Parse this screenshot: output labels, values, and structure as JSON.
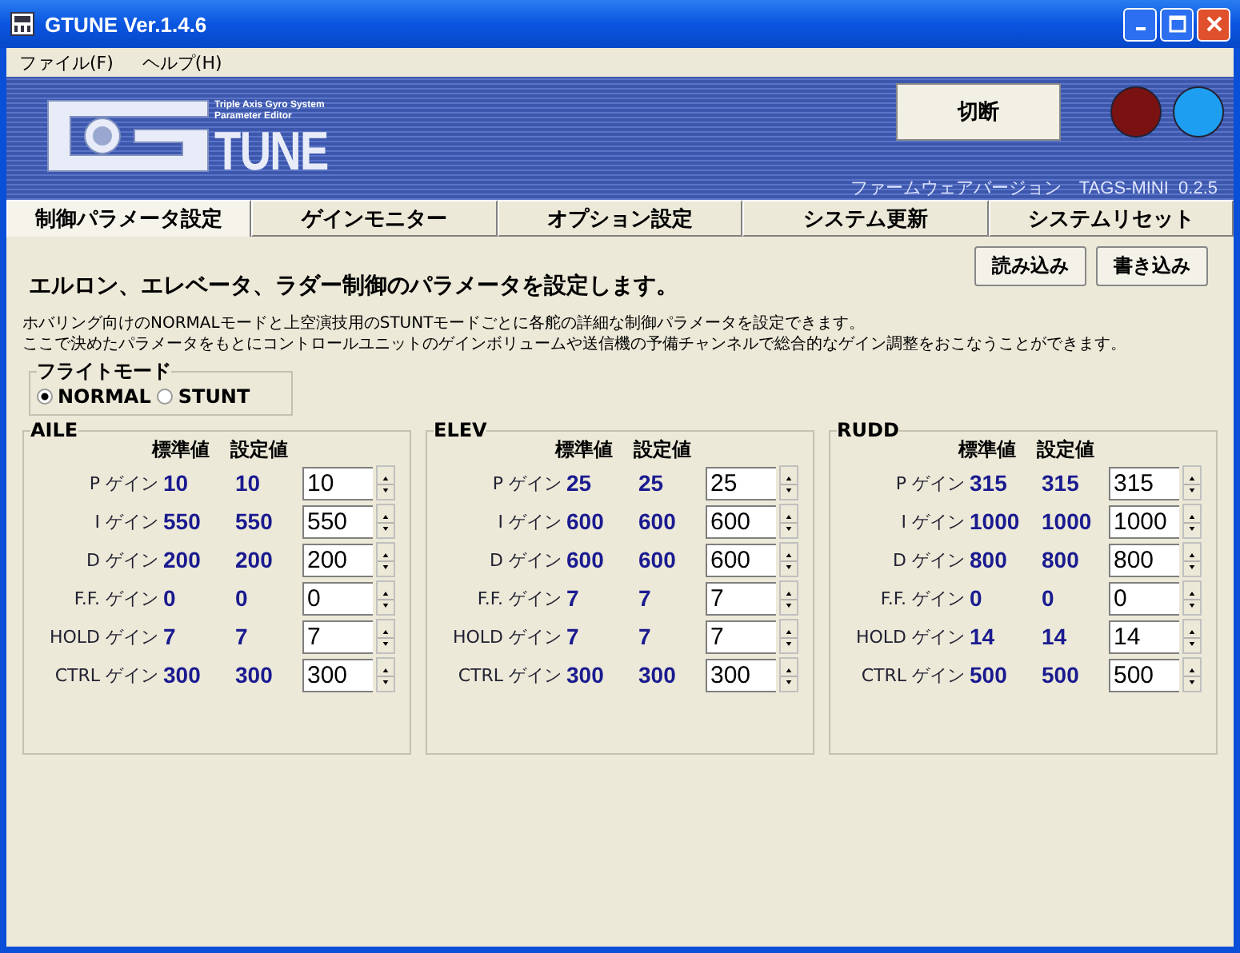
{
  "window": {
    "title": "GTUNE Ver.1.4.6"
  },
  "menu": [
    "ファイル(F)",
    "ヘルプ(H)"
  ],
  "banner": {
    "logo_tagline": [
      "Triple Axis Gyro System",
      "Parameter Editor"
    ],
    "logo_text": "TUNE",
    "connect_button": "切断",
    "firmware": "ファームウェアバージョン　TAGS-MINI  0.2.5",
    "leds": [
      {
        "color": "#7a1212"
      },
      {
        "color": "#1e9ef0"
      }
    ]
  },
  "tabs": [
    {
      "label": "制御パラメータ設定",
      "selected": true
    },
    {
      "label": "ゲインモニター",
      "selected": false
    },
    {
      "label": "オプション設定",
      "selected": false
    },
    {
      "label": "システム更新",
      "selected": false
    },
    {
      "label": "システムリセット",
      "selected": false
    }
  ],
  "buttons": [
    "読み込み",
    "書き込み"
  ],
  "heading": "エルロン、エレベータ、ラダー制御のパラメータを設定します。",
  "description": [
    "ホバリング向けのNORMALモードと上空演技用のSTUNTモードごとに各舵の詳細な制御パラメータを設定できます。",
    "ここで決めたパラメータをもとにコントロールユニットのゲインボリュームや送信機の予備チャンネルで総合的なゲイン調整をおこなうことができます。"
  ],
  "flight_mode": {
    "label": "フライトモード",
    "options": [
      {
        "label": "NORMAL",
        "selected": true
      },
      {
        "label": "STUNT",
        "selected": false
      }
    ]
  },
  "axes": [
    {
      "title": "AILE",
      "headers": [
        "標準値",
        "設定値"
      ],
      "rows": [
        {
          "label": "P ゲイン",
          "standard": "10",
          "setting": "10",
          "value": "10"
        },
        {
          "label": "I ゲイン",
          "standard": "550",
          "setting": "550",
          "value": "550"
        },
        {
          "label": "D ゲイン",
          "standard": "200",
          "setting": "200",
          "value": "200"
        },
        {
          "label": "F.F. ゲイン",
          "standard": "0",
          "setting": "0",
          "value": "0"
        },
        {
          "label": "HOLD ゲイン",
          "standard": "7",
          "setting": "7",
          "value": "7"
        },
        {
          "label": "CTRL ゲイン",
          "standard": "300",
          "setting": "300",
          "value": "300"
        }
      ]
    },
    {
      "title": "ELEV",
      "headers": [
        "標準値",
        "設定値"
      ],
      "rows": [
        {
          "label": "P ゲイン",
          "standard": "25",
          "setting": "25",
          "value": "25"
        },
        {
          "label": "I ゲイン",
          "standard": "600",
          "setting": "600",
          "value": "600"
        },
        {
          "label": "D ゲイン",
          "standard": "600",
          "setting": "600",
          "value": "600"
        },
        {
          "label": "F.F. ゲイン",
          "standard": "7",
          "setting": "7",
          "value": "7"
        },
        {
          "label": "HOLD ゲイン",
          "standard": "7",
          "setting": "7",
          "value": "7"
        },
        {
          "label": "CTRL ゲイン",
          "standard": "300",
          "setting": "300",
          "value": "300"
        }
      ]
    },
    {
      "title": "RUDD",
      "headers": [
        "標準値",
        "設定値"
      ],
      "rows": [
        {
          "label": "P ゲイン",
          "standard": "315",
          "setting": "315",
          "value": "315"
        },
        {
          "label": "I ゲイン",
          "standard": "1000",
          "setting": "1000",
          "value": "1000"
        },
        {
          "label": "D ゲイン",
          "standard": "800",
          "setting": "800",
          "value": "800"
        },
        {
          "label": "F.F. ゲイン",
          "standard": "0",
          "setting": "0",
          "value": "0"
        },
        {
          "label": "HOLD ゲイン",
          "standard": "14",
          "setting": "14",
          "value": "14"
        },
        {
          "label": "CTRL ゲイン",
          "standard": "500",
          "setting": "500",
          "value": "500"
        }
      ]
    }
  ]
}
